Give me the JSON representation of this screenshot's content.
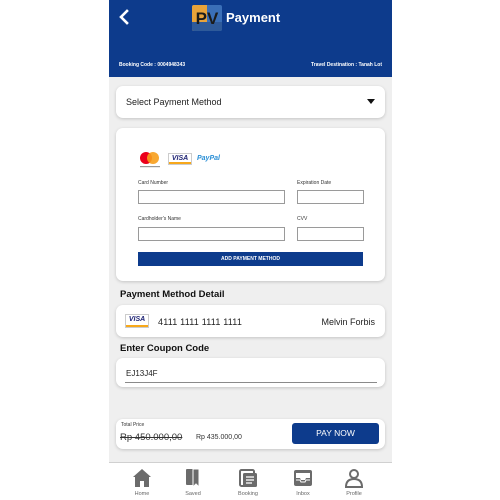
{
  "header": {
    "title": "Payment",
    "booking_code": "Booking Code : 0004948343",
    "destination": "Travel Destination : Tanah Lot",
    "logo_text": "PV"
  },
  "payment_select": {
    "label": "Select Payment Method"
  },
  "form": {
    "brands": [
      "mastercard-icon",
      "visa-icon",
      "paypal-icon"
    ],
    "visa_text": "VISA",
    "paypal_text": "PayPal",
    "card_number_label": "Card Number",
    "expiration_label": "Expiration Date",
    "cardholder_label": "Cardholder's Name",
    "cvv_label": "CVV",
    "add_button": "ADD PAYMENT METHOD"
  },
  "detail": {
    "title": "Payment Method Detail",
    "card_brand": "VISA",
    "card_number": "4111 1111 1111 1111",
    "card_holder": "Melvin Forbis"
  },
  "coupon": {
    "title": "Enter Coupon Code",
    "value": "EJ13J4F"
  },
  "price": {
    "label": "Total Price",
    "old_price": "Rp 450.000,00",
    "new_price": "Rp 435.000,00",
    "pay_button": "PAY NOW"
  },
  "nav": {
    "items": [
      {
        "label": "Home",
        "icon": "home-icon"
      },
      {
        "label": "Saved",
        "icon": "bookmark-icon"
      },
      {
        "label": "Booking",
        "icon": "booking-icon"
      },
      {
        "label": "Inbox",
        "icon": "inbox-icon"
      },
      {
        "label": "Profile",
        "icon": "profile-icon"
      }
    ]
  },
  "colors": {
    "primary": "#0d3b8c",
    "background": "#efefef",
    "nav_icon": "#6b6b6b"
  }
}
